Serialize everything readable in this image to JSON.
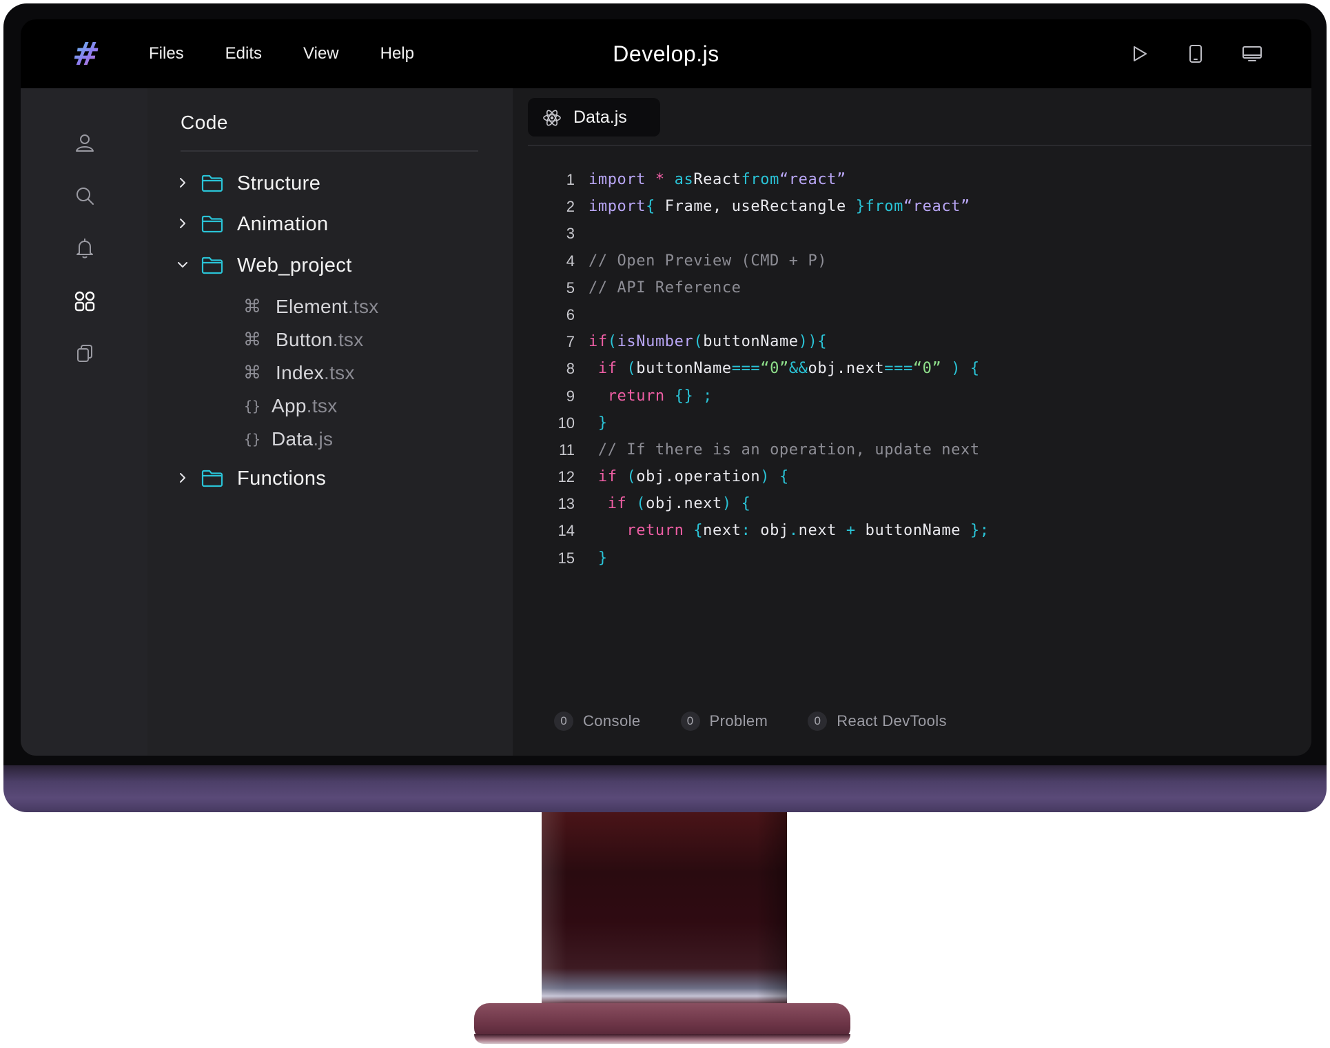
{
  "app": {
    "title": "Develop.js",
    "logo_glyph": "#",
    "logo_gradient": [
      "#4cd3e8",
      "#8f7cf0",
      "#e46fb4"
    ]
  },
  "menu": [
    "Files",
    "Edits",
    "View",
    "Help"
  ],
  "top_actions": [
    {
      "icon": "play-icon"
    },
    {
      "icon": "tablet-icon"
    },
    {
      "icon": "desktop-icon"
    }
  ],
  "rail": [
    {
      "icon": "user-icon",
      "active": false
    },
    {
      "icon": "search-icon",
      "active": false
    },
    {
      "icon": "bell-icon",
      "active": false
    },
    {
      "icon": "apps-grid-icon",
      "active": true
    },
    {
      "icon": "copy-icon",
      "active": false
    }
  ],
  "explorer": {
    "title": "Code",
    "folders": [
      {
        "name": "Structure",
        "expanded": false
      },
      {
        "name": "Animation",
        "expanded": false
      },
      {
        "name": "Web_project",
        "expanded": true
      },
      {
        "name": "Functions",
        "expanded": false
      }
    ],
    "files": [
      {
        "icon": "command-icon",
        "glyph": "⌘",
        "base": "Element",
        "ext": ".tsx"
      },
      {
        "icon": "command-icon",
        "glyph": "⌘",
        "base": "Button",
        "ext": ".tsx"
      },
      {
        "icon": "command-icon",
        "glyph": "⌘",
        "base": "Index",
        "ext": ".tsx"
      },
      {
        "icon": "braces-icon",
        "glyph": "{}",
        "base": "App",
        "ext": ".tsx"
      },
      {
        "icon": "braces-icon",
        "glyph": "{}",
        "base": "Data",
        "ext": ".js"
      }
    ]
  },
  "editor": {
    "tab": {
      "label": "Data.js",
      "icon": "react-atom-icon"
    },
    "line_numbers": [
      "1",
      "2",
      "3",
      "4",
      "5",
      "6",
      "7",
      "8",
      "9",
      "10",
      "11",
      "12",
      "13",
      "14",
      "15"
    ],
    "lines": [
      [
        [
          "k",
          "import "
        ],
        [
          "p",
          "* "
        ],
        [
          "c",
          "as"
        ],
        [
          "w",
          "React"
        ],
        [
          "c",
          "from"
        ],
        [
          "k",
          "“react”"
        ]
      ],
      [
        [
          "k",
          "import"
        ],
        [
          "c",
          "{ "
        ],
        [
          "w",
          "Frame, useRectangle "
        ],
        [
          "c",
          "}"
        ],
        [
          "c",
          "from"
        ],
        [
          "k",
          "“react”"
        ]
      ],
      [],
      [
        [
          "cm",
          "// Open Preview (CMD + P)"
        ]
      ],
      [
        [
          "cm",
          "// API Reference"
        ]
      ],
      [],
      [
        [
          "p",
          "if"
        ],
        [
          "c",
          "("
        ],
        [
          "k",
          "isNumber"
        ],
        [
          "c",
          "("
        ],
        [
          "w",
          "buttonName"
        ],
        [
          "c",
          "))"
        ],
        [
          "c",
          "{"
        ]
      ],
      [
        [
          "w",
          " "
        ],
        [
          "p",
          "if "
        ],
        [
          "c",
          "("
        ],
        [
          "w",
          "buttonName"
        ],
        [
          "c",
          "==="
        ],
        [
          "s",
          "“0”"
        ],
        [
          "c",
          "&&"
        ],
        [
          "w",
          "obj.next"
        ],
        [
          "c",
          "==="
        ],
        [
          "s",
          "“0” "
        ],
        [
          "c",
          ") {"
        ]
      ],
      [
        [
          "w",
          "  "
        ],
        [
          "p",
          "return "
        ],
        [
          "c",
          "{} ;"
        ]
      ],
      [
        [
          "w",
          " "
        ],
        [
          "c",
          "}"
        ]
      ],
      [
        [
          "w",
          " "
        ],
        [
          "cm",
          "// If there is an operation, update next"
        ]
      ],
      [
        [
          "w",
          " "
        ],
        [
          "p",
          "if "
        ],
        [
          "c",
          "("
        ],
        [
          "w",
          "obj.operation"
        ],
        [
          "c",
          ") {"
        ]
      ],
      [
        [
          "w",
          "  "
        ],
        [
          "p",
          "if "
        ],
        [
          "c",
          "("
        ],
        [
          "w",
          "obj.next"
        ],
        [
          "c",
          ") {"
        ]
      ],
      [
        [
          "w",
          "    "
        ],
        [
          "p",
          "return "
        ],
        [
          "c",
          "{"
        ],
        [
          "w",
          "next"
        ],
        [
          "c",
          ": "
        ],
        [
          "w",
          "obj"
        ],
        [
          "c",
          "."
        ],
        [
          "w",
          "next "
        ],
        [
          "c",
          "+ "
        ],
        [
          "w",
          "buttonName "
        ],
        [
          "c",
          "};"
        ]
      ],
      [
        [
          "w",
          " "
        ],
        [
          "c",
          "}"
        ]
      ]
    ],
    "colors": {
      "k": "#b9a6f5",
      "c": "#2ac3d6",
      "p": "#ee5ea4",
      "s": "#8fe08b",
      "w": "#e9e9ee",
      "cm": "#8d8d95"
    }
  },
  "status": [
    {
      "count": "0",
      "label": "Console"
    },
    {
      "count": "0",
      "label": "Problem"
    },
    {
      "count": "0",
      "label": "React DevTools"
    }
  ]
}
